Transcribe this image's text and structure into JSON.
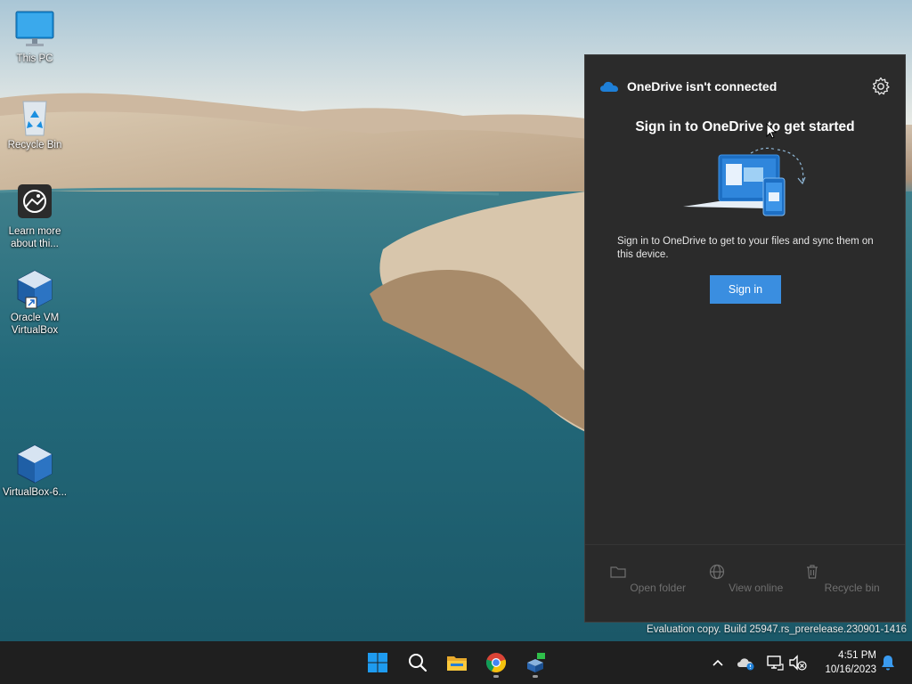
{
  "desktop": {
    "icons": [
      {
        "label": "This PC",
        "icon": "monitor-icon"
      },
      {
        "label": "Recycle Bin",
        "icon": "recycle-bin-icon"
      },
      {
        "label": "Learn more\nabout thi...",
        "icon": "learn-more-icon"
      },
      {
        "label": "Oracle VM\nVirtualBox",
        "icon": "virtualbox-icon"
      },
      {
        "label": "VirtualBox-6...",
        "icon": "virtualbox-icon"
      }
    ]
  },
  "onedrive": {
    "title": "OneDrive isn't connected",
    "heading": "Sign in to OneDrive to get started",
    "description": "Sign in to OneDrive to get to your files and sync them on this device.",
    "signin_label": "Sign in",
    "footer": [
      {
        "label": "Open folder",
        "icon": "folder-icon"
      },
      {
        "label": "View online",
        "icon": "globe-icon"
      },
      {
        "label": "Recycle bin",
        "icon": "trash-icon"
      }
    ],
    "colors": {
      "panel": "#2b2b2b",
      "accent": "#3a8ee0"
    }
  },
  "watermark": "Evaluation copy. Build 25947.rs_prerelease.230901-1416",
  "taskbar": {
    "apps": [
      "start-icon",
      "search-icon",
      "file-explorer-icon",
      "chrome-icon",
      "virtualbox-icon"
    ],
    "tray": [
      "chevron-up-icon",
      "onedrive-tray-icon",
      "network-icon",
      "volume-muted-icon",
      "notification-bell-icon"
    ],
    "time": "4:51 PM",
    "date": "10/16/2023"
  }
}
